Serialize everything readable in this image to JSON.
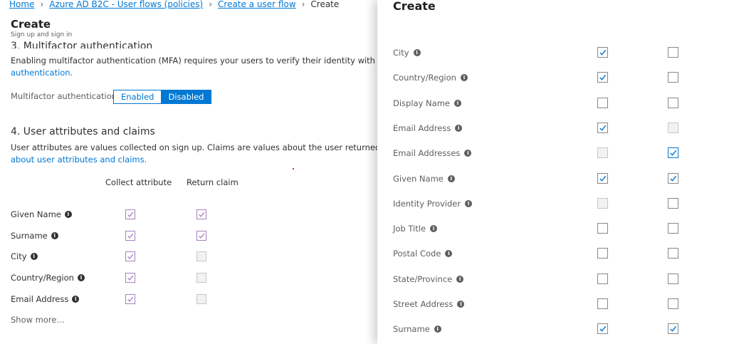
{
  "breadcrumb": {
    "home": "Home",
    "b2c": "Azure AD B2C - User flows (policies)",
    "create_flow": "Create a user flow",
    "current": "Create"
  },
  "blade": {
    "title": "Create",
    "subtitle": "Sign up and sign in",
    "mfa": {
      "heading": "3. Multifactor authentication",
      "desc_line1": "Enabling multifactor authentication (MFA) requires your users to verify their identity with a seconc",
      "desc_link": "authentication.",
      "toggle_label": "Multifactor authentication",
      "enabled": "Enabled",
      "disabled": "Disabled",
      "selected": "Disabled"
    },
    "attributes": {
      "heading": "4. User attributes and claims",
      "desc_line1": "User attributes are values collected on sign up. Claims are values about the user returned to the a",
      "desc_link": "about user attributes and claims.",
      "col_collect": "Collect attribute",
      "col_return": "Return claim",
      "rows": [
        {
          "label": "Given Name",
          "collect": true,
          "return": true
        },
        {
          "label": "Surname",
          "collect": true,
          "return": true
        },
        {
          "label": "City",
          "collect": true,
          "return": false
        },
        {
          "label": "Country/Region",
          "collect": true,
          "return": false
        },
        {
          "label": "Email Address",
          "collect": true,
          "return": false
        }
      ],
      "show_more": "Show more..."
    }
  },
  "panel": {
    "title": "Create",
    "rows": [
      {
        "label": "City",
        "collect": "checked",
        "return": "unchecked"
      },
      {
        "label": "Country/Region",
        "collect": "checked",
        "return": "unchecked"
      },
      {
        "label": "Display Name",
        "collect": "unchecked",
        "return": "unchecked"
      },
      {
        "label": "Email Address",
        "collect": "checked",
        "return": "disabled"
      },
      {
        "label": "Email Addresses",
        "collect": "disabled",
        "return": "checked-focused"
      },
      {
        "label": "Given Name",
        "collect": "checked",
        "return": "checked"
      },
      {
        "label": "Identity Provider",
        "collect": "disabled",
        "return": "unchecked"
      },
      {
        "label": "Job Title",
        "collect": "unchecked",
        "return": "unchecked"
      },
      {
        "label": "Postal Code",
        "collect": "unchecked",
        "return": "unchecked"
      },
      {
        "label": "State/Province",
        "collect": "unchecked",
        "return": "unchecked"
      },
      {
        "label": "Street Address",
        "collect": "unchecked",
        "return": "unchecked"
      },
      {
        "label": "Surname",
        "collect": "checked",
        "return": "checked"
      }
    ]
  },
  "icons": {
    "info": "info-icon",
    "check": "checkmark-icon"
  },
  "colors": {
    "accent": "#0078d4",
    "bg_check": "#a67fbf"
  }
}
